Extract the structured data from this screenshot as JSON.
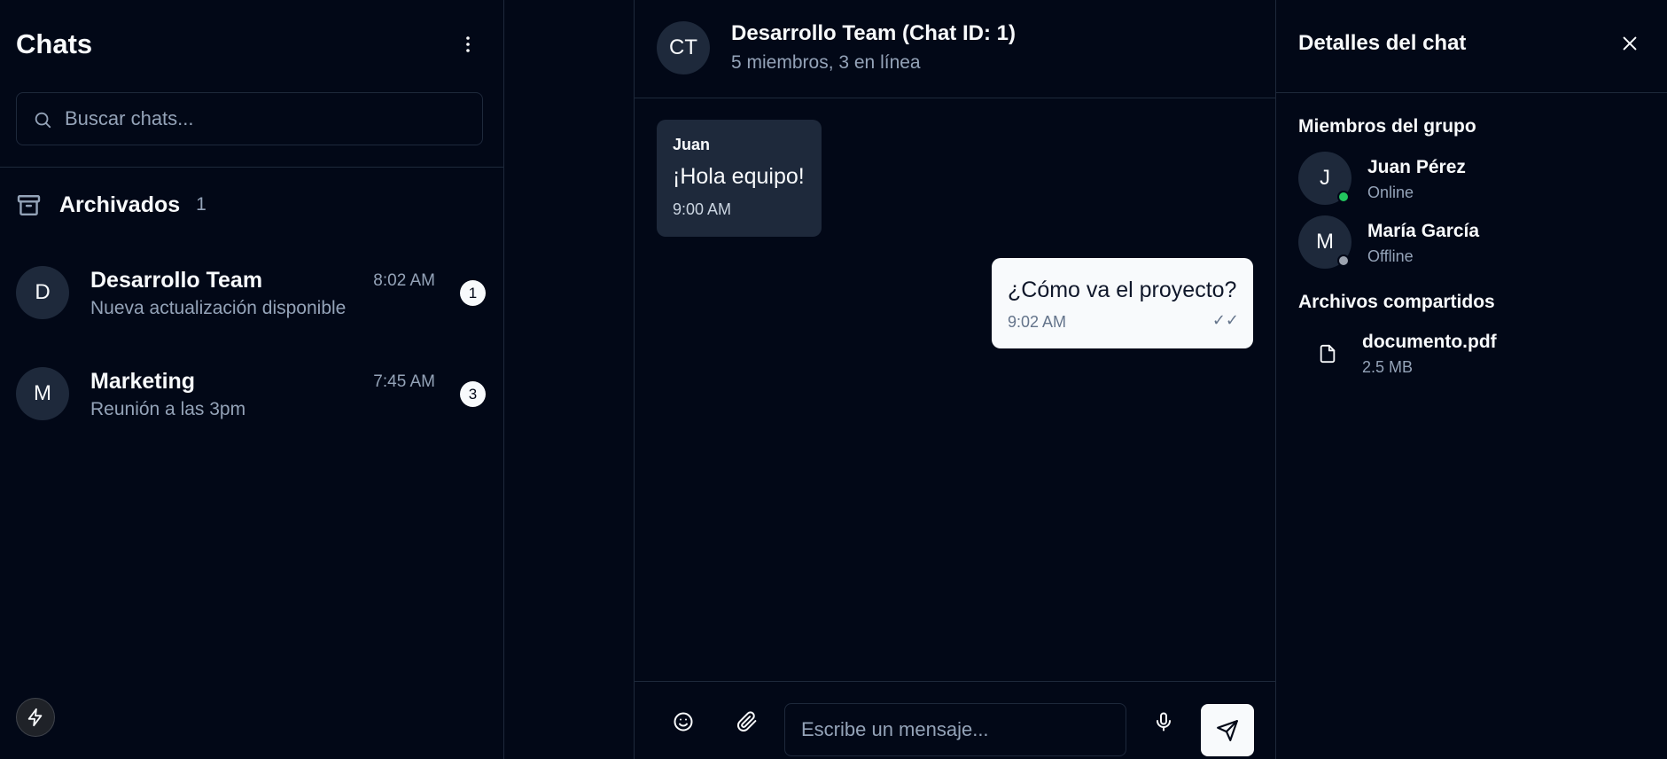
{
  "sidebar": {
    "title": "Chats",
    "search_placeholder": "Buscar chats...",
    "archived": {
      "label": "Archivados",
      "count": "1"
    },
    "chats": [
      {
        "initial": "D",
        "name": "Desarrollo Team",
        "time": "8:02 AM",
        "preview": "Nueva actualización disponible",
        "unread": "1"
      },
      {
        "initial": "M",
        "name": "Marketing",
        "time": "7:45 AM",
        "preview": "Reunión a las 3pm",
        "unread": "3"
      }
    ]
  },
  "chat": {
    "avatar": "CT",
    "title": "Desarrollo Team (Chat ID: 1)",
    "subtitle": "5 miembros, 3 en línea",
    "messages": [
      {
        "direction": "incoming",
        "sender": "Juan",
        "text": "¡Hola equipo!",
        "time": "9:00 AM"
      },
      {
        "direction": "outgoing",
        "text": "¿Cómo va el proyecto?",
        "time": "9:02 AM",
        "status": "✓✓"
      }
    ],
    "composer": {
      "placeholder": "Escribe un mensaje..."
    }
  },
  "details": {
    "title": "Detalles del chat",
    "members_title": "Miembros del grupo",
    "members": [
      {
        "initial": "J",
        "name": "Juan Pérez",
        "status": "Online",
        "status_color": "#22c55e"
      },
      {
        "initial": "M",
        "name": "María García",
        "status": "Offline",
        "status_color": "#9ca3af"
      }
    ],
    "files_title": "Archivos compartidos",
    "files": [
      {
        "name": "documento.pdf",
        "size": "2.5 MB"
      }
    ]
  },
  "colors": {
    "background": "#020817",
    "border": "#1e293b",
    "muted_text": "#94a3b8",
    "primary_text": "#f8fafc"
  }
}
